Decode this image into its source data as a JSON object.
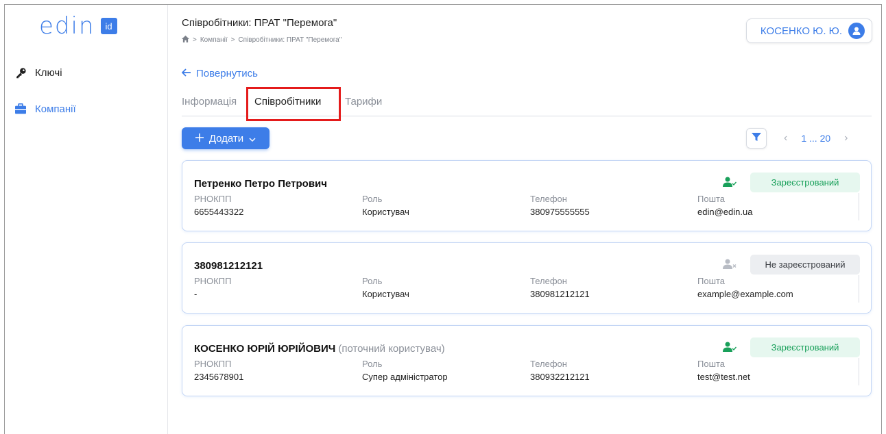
{
  "app": {
    "logo_text": "edin",
    "logo_badge": "id"
  },
  "sidebar": {
    "items": [
      {
        "label": "Ключі",
        "icon": "key-icon"
      },
      {
        "label": "Компанії",
        "icon": "briefcase-icon"
      }
    ]
  },
  "header": {
    "title": "Співробітники: ПРАТ \"Перемога\"",
    "breadcrumb": [
      "Компанії",
      "Співробітники: ПРАТ \"Перемога\""
    ],
    "user": "КОСЕНКО Ю. Ю."
  },
  "back": "Повернутись",
  "tabs": [
    {
      "label": "Інформація"
    },
    {
      "label": "Співробітники",
      "active": true
    },
    {
      "label": "Тарифи"
    }
  ],
  "toolbar": {
    "add_label": "Додати",
    "pager": "1 ... 20"
  },
  "fields": {
    "rnokpp": "РНОКПП",
    "role": "Роль",
    "phone": "Телефон",
    "email": "Пошта"
  },
  "employees": [
    {
      "name": "Петренко Петро Петрович",
      "note": "",
      "rnokpp": "6655443322",
      "role": "Користувач",
      "phone": "380975555555",
      "email": "edin@edin.ua",
      "status": "Зареєстрований"
    },
    {
      "name": "380981212121",
      "note": "",
      "rnokpp": "-",
      "role": "Користувач",
      "phone": "380981212121",
      "email": "example@example.com",
      "status": "Не зареєстрований"
    },
    {
      "name": "КОСЕНКО ЮРІЙ ЮРІЙОВИЧ",
      "note": "(поточний користувач)",
      "rnokpp": "2345678901",
      "role": "Супер адміністратор",
      "phone": "380932212121",
      "email": "test@test.net",
      "status": "Зареєстрований"
    }
  ],
  "colors": {
    "accent": "#3d7de8",
    "registered": "#19a05a",
    "highlight": "#e41b1b"
  }
}
